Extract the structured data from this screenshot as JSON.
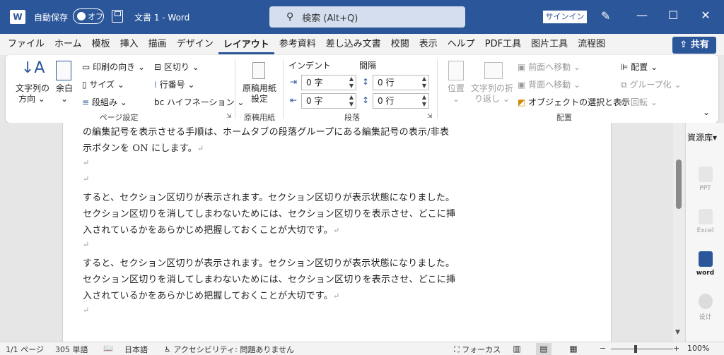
{
  "titlebar": {
    "app_icon": "W",
    "autosave_label": "自動保存",
    "autosave_state": "オフ",
    "doc_title": "文書 1  -  Word",
    "search_placeholder": "検索 (Alt+Q)",
    "signin_label": "サインイン",
    "minimize": "—",
    "maximize": "☐",
    "close": "✕"
  },
  "tabs": [
    "ファイル",
    "ホーム",
    "模板",
    "挿入",
    "描画",
    "デザイン",
    "レイアウト",
    "参考資料",
    "差し込み文書",
    "校閲",
    "表示",
    "ヘルプ",
    "PDF工具",
    "图片工具",
    "流程图"
  ],
  "active_tab": "レイアウト",
  "share_label": "共有",
  "ribbon": {
    "page_setup": {
      "text_direction": [
        "文字列の",
        "方向 ⌄"
      ],
      "margins": [
        "余白",
        "⌄"
      ],
      "orientation": "印刷の向き ⌄",
      "size": "サイズ ⌄",
      "columns": "段組み ⌄",
      "breaks": "区切り ⌄",
      "line_numbers": "行番号 ⌄",
      "hyphenation": "ハイフネーション ⌄",
      "label": "ページ設定"
    },
    "genko": {
      "button": [
        "原稿用紙",
        "設定"
      ],
      "label": "原稿用紙"
    },
    "paragraph": {
      "indent_header": "インデント",
      "spacing_header": "間隔",
      "indent_left": "0 字",
      "indent_right": "0 字",
      "space_before": "0 行",
      "space_after": "0 行",
      "label": "段落"
    },
    "arrange": {
      "position": [
        "位置",
        "⌄"
      ],
      "wrap_text": [
        "文字列の折",
        "り返し ⌄"
      ],
      "bring_forward": "前面へ移動",
      "send_backward": "背面へ移動",
      "selection_pane": "オブジェクトの選択と表示",
      "align": "配置 ⌄",
      "group": "グループ化 ⌄",
      "rotate": "回転 ⌄",
      "label": "配置"
    }
  },
  "document": {
    "lines": [
      "の編集記号を表示させる手順は、ホームタブの段落グループにある編集記号の表示/非表",
      "示ボタンを ON にします。",
      "",
      "",
      "すると、セクション区切りが表示されます。セクション区切りが表示状態になりました。",
      "セクション区切りを消してしまわないためには、セクション区切りを表示させ、どこに挿",
      "入されているかをあらかじめ把握しておくことが大切です。",
      "",
      "すると、セクション区切りが表示されます。セクション区切りが表示状態になりました。",
      "セクション区切りを消してしまわないためには、セクション区切りを表示させ、どこに挿",
      "入されているかをあらかじめ把握しておくことが大切です。",
      ""
    ],
    "paragraph_mark": "↵"
  },
  "sidepane": {
    "title": "資源库",
    "items": [
      {
        "label": "PPT",
        "icon": "ppt-icon",
        "color": "#d24726"
      },
      {
        "label": "Excel",
        "icon": "excel-icon",
        "color": "#217346"
      },
      {
        "label": "word",
        "icon": "word-icon",
        "color": "#2b579a"
      },
      {
        "label": "设计",
        "icon": "design-icon",
        "color": "#c8c8c8"
      }
    ]
  },
  "status": {
    "page": "1/1 ページ",
    "words": "305 単語",
    "language": "日本語",
    "accessibility": "アクセシビリティ: 問題ありません",
    "focus": "フォーカス",
    "zoom_minus": "−",
    "zoom_plus": "+",
    "zoom": "100%"
  },
  "colors": {
    "title_bar": "#2b579a",
    "accent": "#2b579a"
  }
}
